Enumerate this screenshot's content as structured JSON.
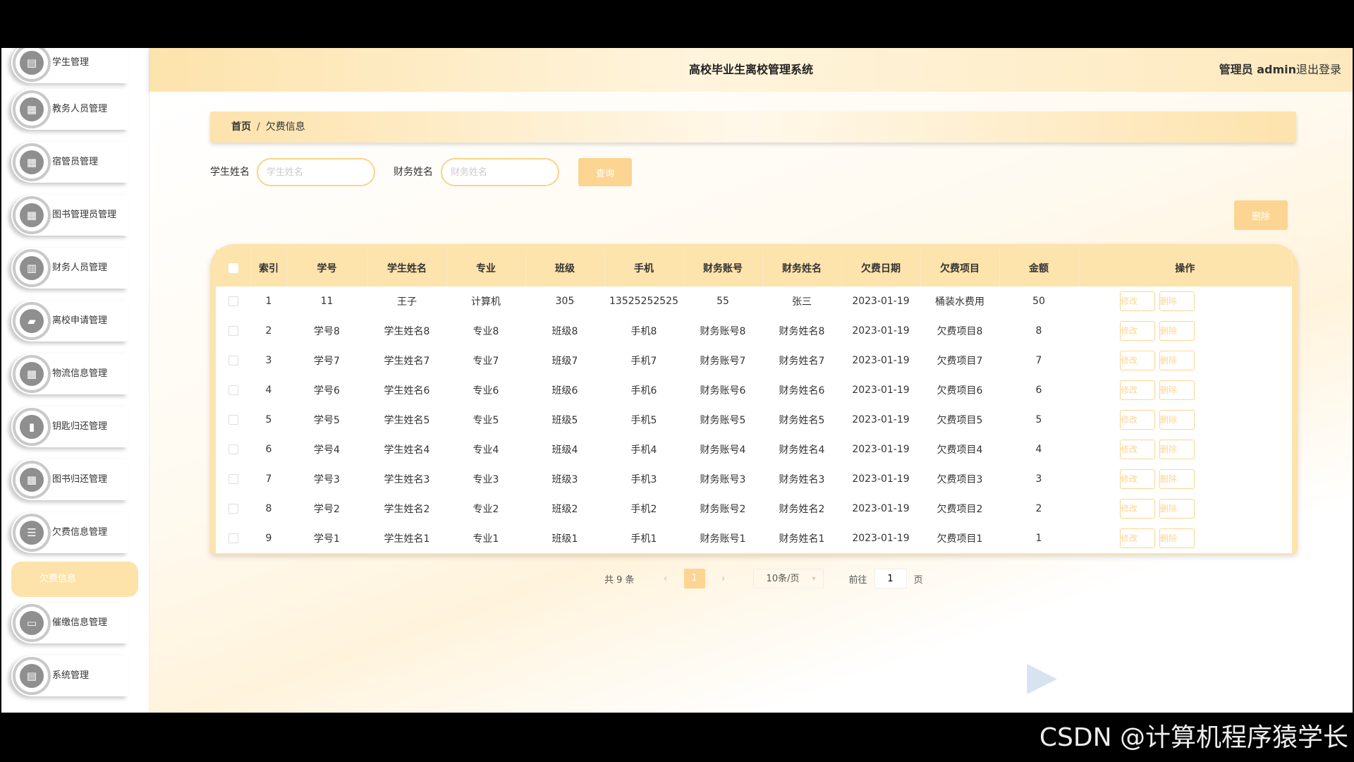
{
  "app": {
    "title": "高校毕业生离校管理系统"
  },
  "header": {
    "admin_text": "管理员 admin",
    "logout_label": "退出登录"
  },
  "sidebar": {
    "items": [
      {
        "label": "学生管理",
        "icon": "clipboard-icon",
        "glyph": "▤"
      },
      {
        "label": "教务人员管理",
        "icon": "grid-icon",
        "glyph": "▦"
      },
      {
        "label": "宿管员管理",
        "icon": "grid-icon",
        "glyph": "▦"
      },
      {
        "label": "图书管理员管理",
        "icon": "grid-icon",
        "glyph": "▦"
      },
      {
        "label": "财务人员管理",
        "icon": "document-icon",
        "glyph": "▥"
      },
      {
        "label": "离校申请管理",
        "icon": "folder-icon",
        "glyph": "▰"
      },
      {
        "label": "物流信息管理",
        "icon": "grid-icon",
        "glyph": "▦"
      },
      {
        "label": "钥匙归还管理",
        "icon": "bar-chart-icon",
        "glyph": "▮"
      },
      {
        "label": "图书归还管理",
        "icon": "grid-icon",
        "glyph": "▦"
      },
      {
        "label": "欠费信息管理",
        "icon": "list-icon",
        "glyph": "☰"
      },
      {
        "label": "催缴信息管理",
        "icon": "monitor-icon",
        "glyph": "▭"
      },
      {
        "label": "系统管理",
        "icon": "clipboard-icon",
        "glyph": "▤"
      }
    ],
    "active_subitem": "欠费信息"
  },
  "breadcrumb": {
    "home": "首页",
    "separator": "/",
    "current": "欠费信息"
  },
  "search": {
    "student_name_label": "学生姓名",
    "student_name_placeholder": "学生姓名",
    "finance_name_label": "财务姓名",
    "finance_name_placeholder": "财务姓名",
    "query_label": "查询"
  },
  "actions": {
    "delete_label": "删除"
  },
  "table": {
    "columns": [
      "索引",
      "学号",
      "学生姓名",
      "专业",
      "班级",
      "手机",
      "财务账号",
      "财务姓名",
      "欠费日期",
      "欠费项目",
      "金额",
      "操作"
    ],
    "edit_label": "修改",
    "delete_label": "删除",
    "rows": [
      [
        "1",
        "11",
        "王子",
        "计算机",
        "305",
        "13525252525",
        "55",
        "张三",
        "2023-01-19",
        "桶装水费用",
        "50"
      ],
      [
        "2",
        "学号8",
        "学生姓名8",
        "专业8",
        "班级8",
        "手机8",
        "财务账号8",
        "财务姓名8",
        "2023-01-19",
        "欠费项目8",
        "8"
      ],
      [
        "3",
        "学号7",
        "学生姓名7",
        "专业7",
        "班级7",
        "手机7",
        "财务账号7",
        "财务姓名7",
        "2023-01-19",
        "欠费项目7",
        "7"
      ],
      [
        "4",
        "学号6",
        "学生姓名6",
        "专业6",
        "班级6",
        "手机6",
        "财务账号6",
        "财务姓名6",
        "2023-01-19",
        "欠费项目6",
        "6"
      ],
      [
        "5",
        "学号5",
        "学生姓名5",
        "专业5",
        "班级5",
        "手机5",
        "财务账号5",
        "财务姓名5",
        "2023-01-19",
        "欠费项目5",
        "5"
      ],
      [
        "6",
        "学号4",
        "学生姓名4",
        "专业4",
        "班级4",
        "手机4",
        "财务账号4",
        "财务姓名4",
        "2023-01-19",
        "欠费项目4",
        "4"
      ],
      [
        "7",
        "学号3",
        "学生姓名3",
        "专业3",
        "班级3",
        "手机3",
        "财务账号3",
        "财务姓名3",
        "2023-01-19",
        "欠费项目3",
        "3"
      ],
      [
        "8",
        "学号2",
        "学生姓名2",
        "专业2",
        "班级2",
        "手机2",
        "财务账号2",
        "财务姓名2",
        "2023-01-19",
        "欠费项目2",
        "2"
      ],
      [
        "9",
        "学号1",
        "学生姓名1",
        "专业1",
        "班级1",
        "手机1",
        "财务账号1",
        "财务姓名1",
        "2023-01-19",
        "欠费项目1",
        "1"
      ]
    ]
  },
  "pagination": {
    "total_text": "共 9 条",
    "prev": "‹",
    "current_page": "1",
    "next": "›",
    "page_size": "10条/页",
    "goto_prefix": "前往",
    "goto_value": "1",
    "goto_suffix": "页"
  },
  "watermark": "CSDN @计算机程序猿学长",
  "colors": {
    "accent": "#fcd592",
    "header_bg": "#fde3ac",
    "active_menu": "#fde3a9"
  }
}
